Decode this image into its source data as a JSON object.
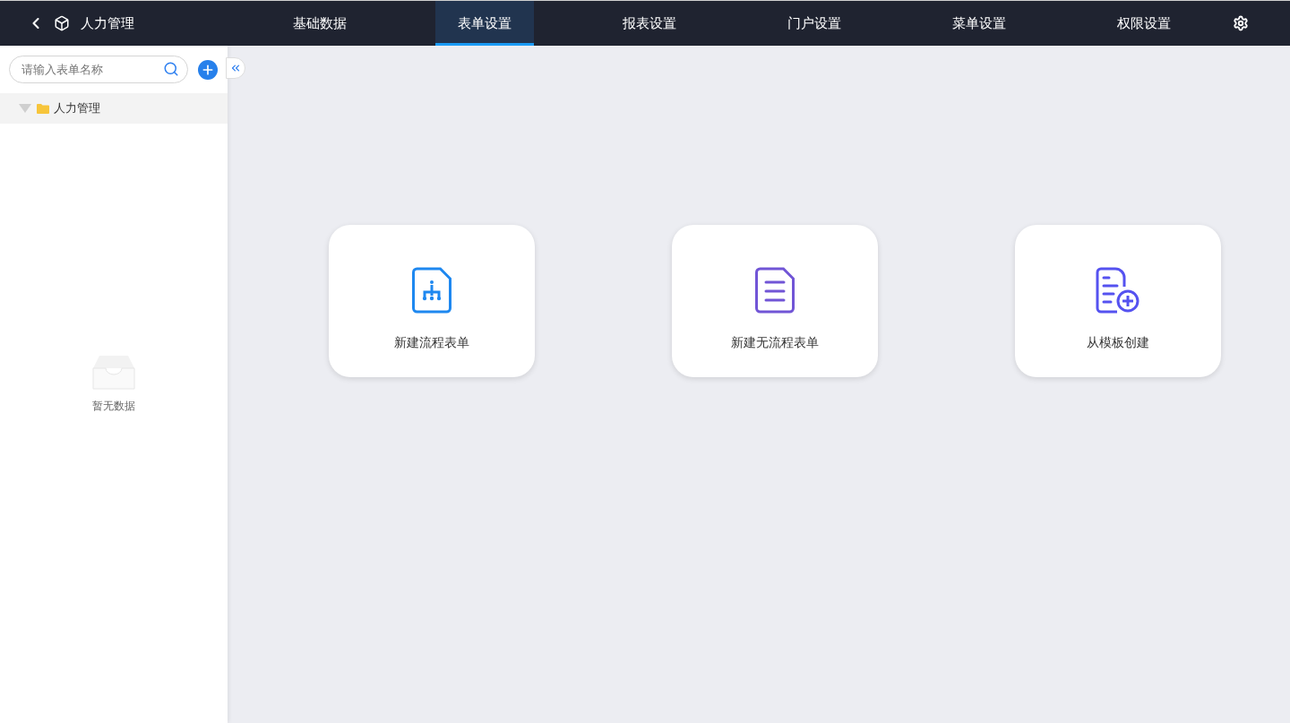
{
  "header": {
    "app_title": "人力管理"
  },
  "tabs": [
    {
      "label": "基础数据",
      "selected": false
    },
    {
      "label": "表单设置",
      "selected": true
    },
    {
      "label": "报表设置",
      "selected": false
    },
    {
      "label": "门户设置",
      "selected": false
    },
    {
      "label": "菜单设置",
      "selected": false
    },
    {
      "label": "权限设置",
      "selected": false
    }
  ],
  "sidebar": {
    "search": {
      "placeholder": "请输入表单名称"
    },
    "tree": [
      {
        "label": "人力管理",
        "expanded": true
      }
    ],
    "empty_text": "暂无数据"
  },
  "cards": [
    {
      "kind": "flow",
      "label": "新建流程表单"
    },
    {
      "kind": "plain",
      "label": "新建无流程表单"
    },
    {
      "kind": "template",
      "label": "从模板创建"
    }
  ]
}
